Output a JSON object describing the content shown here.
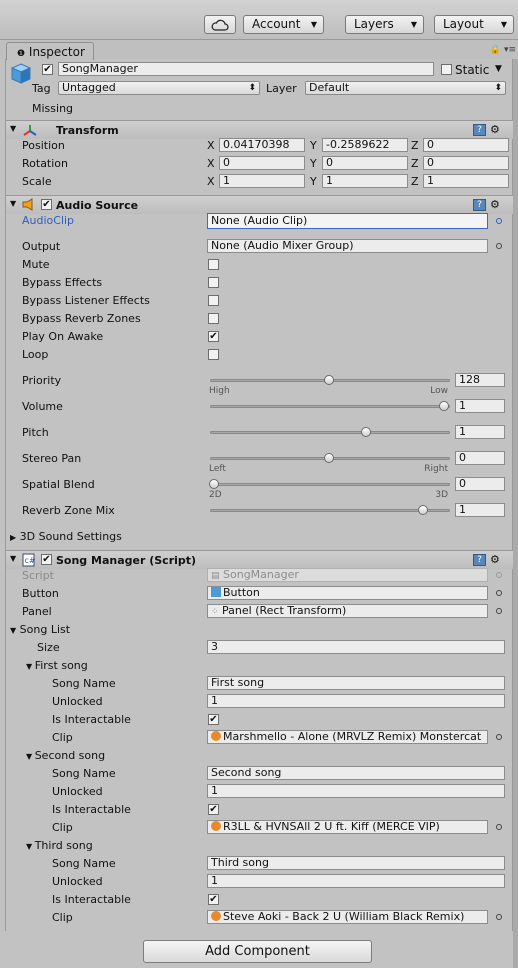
{
  "toolbar": {
    "account": "Account",
    "layers": "Layers",
    "layout": "Layout"
  },
  "tab": {
    "label": "Inspector"
  },
  "header": {
    "name": "SongManager",
    "static_label": "Static",
    "tag_label": "Tag",
    "tag_value": "Untagged",
    "layer_label": "Layer",
    "layer_value": "Default",
    "missing": "Missing"
  },
  "transform": {
    "title": "Transform",
    "rows": [
      {
        "label": "Position",
        "x": "0.04170398",
        "y": "-0.2589622",
        "z": "0"
      },
      {
        "label": "Rotation",
        "x": "0",
        "y": "0",
        "z": "0"
      },
      {
        "label": "Scale",
        "x": "1",
        "y": "1",
        "z": "1"
      }
    ],
    "axis": {
      "x": "X",
      "y": "Y",
      "z": "Z"
    }
  },
  "audio_source": {
    "title": "Audio Source",
    "audio_clip_label": "AudioClip",
    "audio_clip_value": "None (Audio Clip)",
    "output_label": "Output",
    "output_value": "None (Audio Mixer Group)",
    "toggles": [
      {
        "label": "Mute",
        "checked": false
      },
      {
        "label": "Bypass Effects",
        "checked": false
      },
      {
        "label": "Bypass Listener Effects",
        "checked": false
      },
      {
        "label": "Bypass Reverb Zones",
        "checked": false
      },
      {
        "label": "Play On Awake",
        "checked": true
      },
      {
        "label": "Loop",
        "checked": false
      }
    ],
    "priority": {
      "label": "Priority",
      "value": "128",
      "min_label": "High",
      "max_label": "Low",
      "fraction": 0.5
    },
    "volume": {
      "label": "Volume",
      "value": "1",
      "fraction": 1.0
    },
    "pitch": {
      "label": "Pitch",
      "value": "1",
      "fraction": 0.66
    },
    "stereo_pan": {
      "label": "Stereo Pan",
      "value": "0",
      "min_label": "Left",
      "max_label": "Right",
      "fraction": 0.5
    },
    "spatial_blend": {
      "label": "Spatial Blend",
      "value": "0",
      "min_label": "2D",
      "max_label": "3D",
      "fraction": 0.0
    },
    "reverb_zone_mix": {
      "label": "Reverb Zone Mix",
      "value": "1",
      "fraction": 0.91
    },
    "sound_settings": "3D Sound Settings"
  },
  "song_manager": {
    "title": "Song Manager (Script)",
    "script_label": "Script",
    "script_value": "SongManager",
    "button_label": "Button",
    "button_value": "Button",
    "panel_label": "Panel",
    "panel_value": "Panel (Rect Transform)",
    "song_list_label": "Song List",
    "size_label": "Size",
    "size_value": "3",
    "field_labels": {
      "song_name": "Song Name",
      "unlocked": "Unlocked",
      "is_interactable": "Is Interactable",
      "clip": "Clip"
    },
    "songs": [
      {
        "header": "First song",
        "song_name": "First song",
        "unlocked": "1",
        "is_interactable": true,
        "clip": "Marshmello - Alone (MRVLZ Remix) Monstercat"
      },
      {
        "header": "Second song",
        "song_name": "Second song",
        "unlocked": "1",
        "is_interactable": true,
        "clip": "R3LL & HVNSAll 2 U ft. Kiff (MERCE VIP)"
      },
      {
        "header": "Third song",
        "song_name": "Third song",
        "unlocked": "1",
        "is_interactable": true,
        "clip": "Steve Aoki - Back 2 U (William Black Remix)"
      }
    ]
  },
  "add_component": "Add Component",
  "icons": {
    "cloud": "cloud-icon",
    "info": "info-icon",
    "cube": "cube-icon",
    "transform": "transform-axes-icon",
    "speaker": "speaker-icon",
    "script": "script-icon",
    "help": "help-icon",
    "gear": "gear-icon"
  },
  "colors": {
    "accent": "#2f5fbd",
    "clip_icon": "#e8892a"
  }
}
